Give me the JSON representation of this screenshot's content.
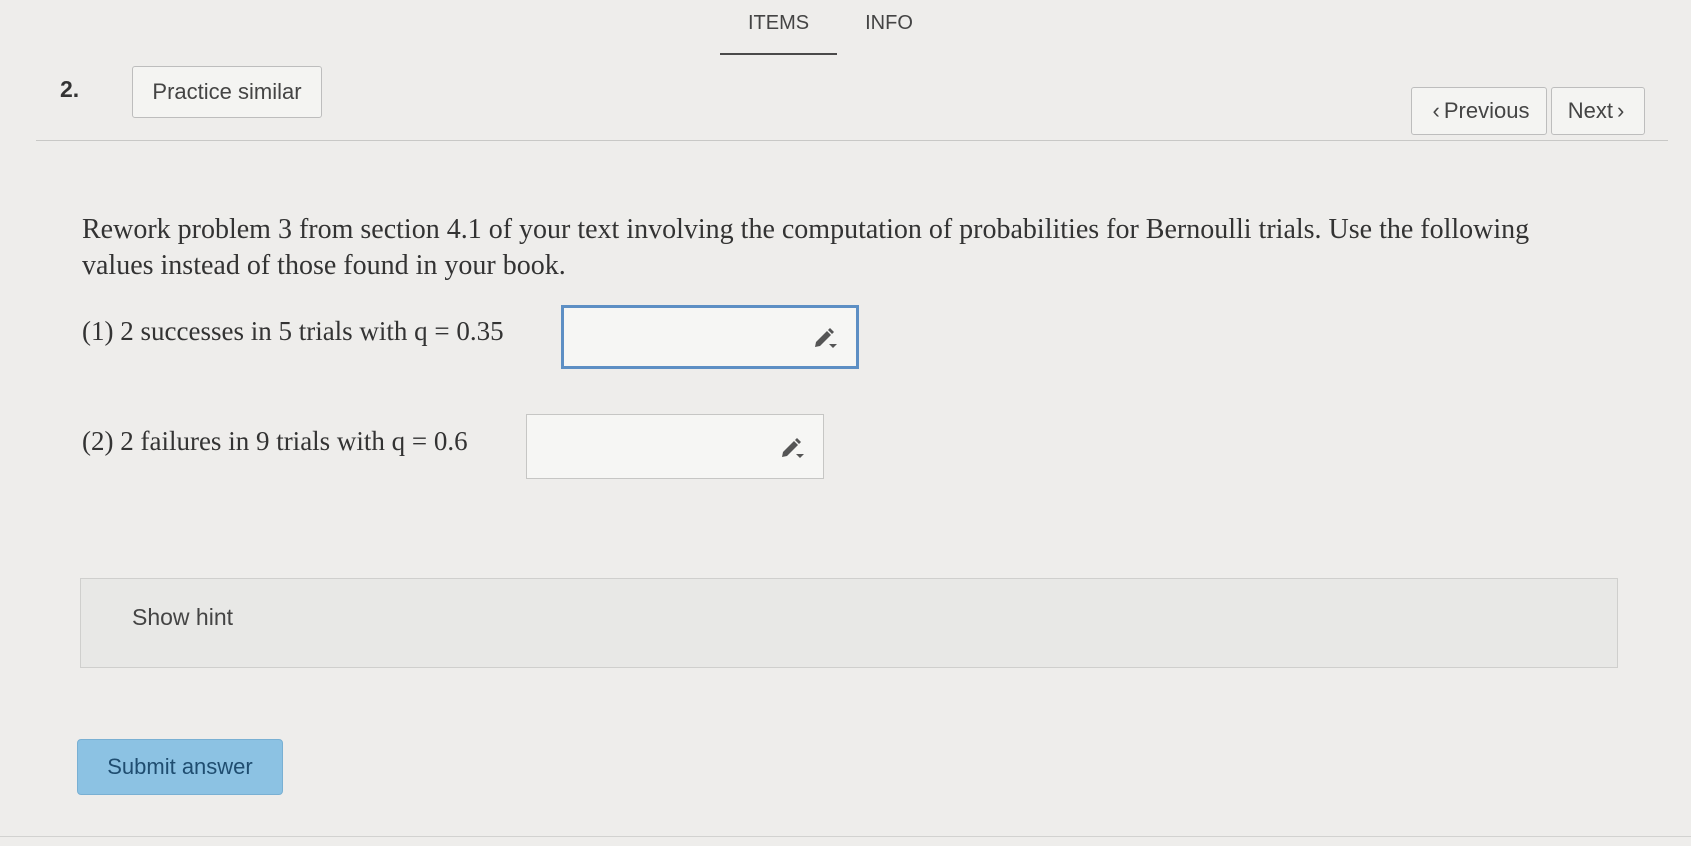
{
  "tabs": [
    {
      "label": "ITEMS",
      "active": true
    },
    {
      "label": "INFO",
      "active": false
    }
  ],
  "question_number": "2.",
  "buttons": {
    "practice_similar": "Practice similar",
    "previous": "Previous",
    "next": "Next",
    "submit": "Submit answer"
  },
  "question": {
    "text": "Rework problem 3 from section 4.1 of your text involving the computation of probabilities for Bernoulli trials. Use the following values instead of those found in your book.",
    "parts": [
      {
        "label": "(1) 2 successes in 5 trials with q = 0.35",
        "value": ""
      },
      {
        "label": "(2) 2 failures in 9 trials with q = 0.6",
        "value": ""
      }
    ]
  },
  "hint": {
    "label": "Show hint"
  },
  "colors": {
    "focus_border": "#5d8fc4",
    "submit_bg": "#8cc2e3",
    "background": "#eeedeb"
  },
  "icons": {
    "answer_tool": "pencil-dropdown-icon"
  }
}
